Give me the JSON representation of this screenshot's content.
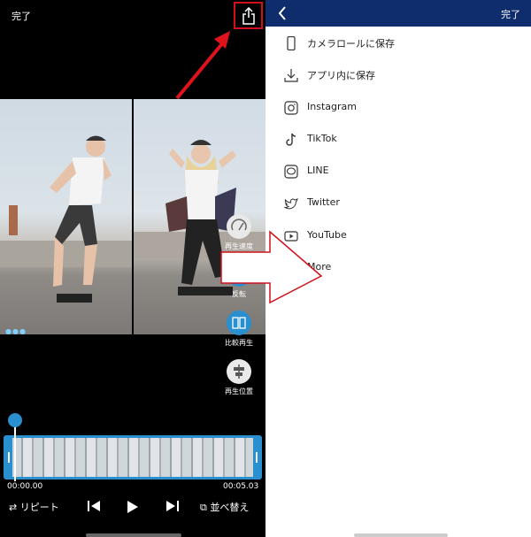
{
  "left": {
    "done_label": "完了",
    "tools": {
      "speed": "再生速度",
      "flip": "反転",
      "compare": "比較再生",
      "position": "再生位置"
    },
    "timecode_start": "00:00.00",
    "timecode_end": "00:05.03",
    "transport": {
      "repeat_label": "リピート",
      "reorder_label": "並べ替え"
    }
  },
  "right": {
    "done_label": "完了",
    "share_items": [
      {
        "label": "カメラロールに保存",
        "icon": "phone-icon"
      },
      {
        "label": "アプリ内に保存",
        "icon": "download-icon"
      },
      {
        "label": "Instagram",
        "icon": "instagram-icon"
      },
      {
        "label": "TikTok",
        "icon": "tiktok-icon"
      },
      {
        "label": "LINE",
        "icon": "line-icon"
      },
      {
        "label": "Twitter",
        "icon": "twitter-icon"
      },
      {
        "label": "YouTube",
        "icon": "youtube-icon"
      },
      {
        "label": "More",
        "icon": "more-icon"
      }
    ]
  },
  "colors": {
    "navbar": "#0f2d6c",
    "accent": "#2a8fcf",
    "annotation_red": "#d0101a"
  }
}
